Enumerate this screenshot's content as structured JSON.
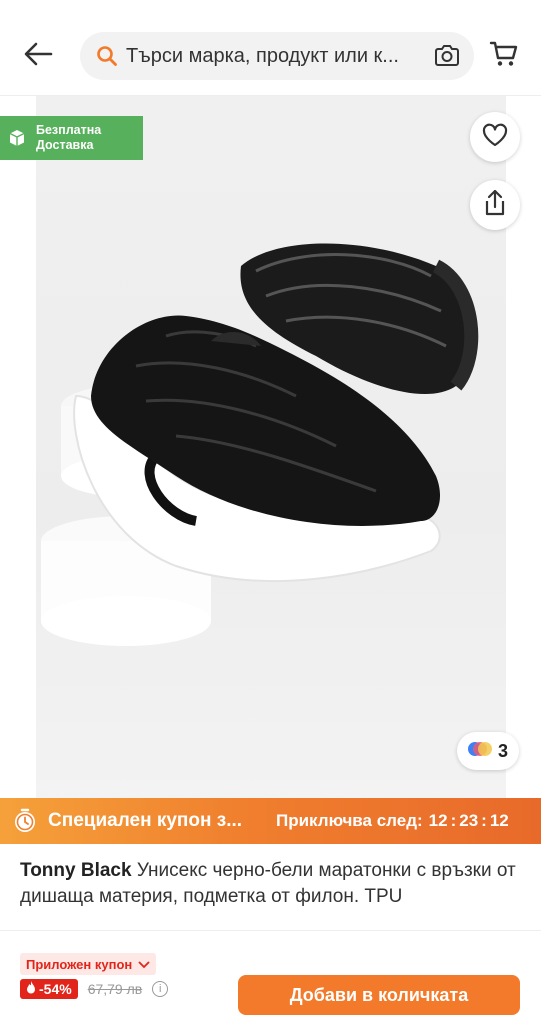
{
  "header": {
    "search_placeholder": "Търси марка, продукт или к...",
    "icons": [
      "back-arrow-icon",
      "search-icon",
      "camera-icon",
      "cart-icon"
    ]
  },
  "product_image": {
    "shipping_badge": {
      "line1": "Безплатна",
      "line2": "Доставка",
      "icon": "box-icon",
      "color": "#57b15c"
    },
    "wishlist_icon": "heart-icon",
    "share_icon": "share-icon",
    "variants_count": "3"
  },
  "coupon_banner": {
    "title": "Специален купон з...",
    "ends_label": "Приключва след:",
    "timer": {
      "hours": "12",
      "minutes": "23",
      "seconds": "12"
    },
    "colors": {
      "start": "#f5a13a",
      "end": "#e86a2a"
    }
  },
  "product": {
    "brand": "Tonny Black",
    "title": "Унисекс черно-бели маратонки с връзки от дишаща материя, подметка от филон. TPU"
  },
  "bottom_bar": {
    "applied_coupon_label": "Приложен купон",
    "discount": "-54%",
    "old_price": "67,79 лв",
    "add_to_cart_label": "Добави в количката",
    "accent_color": "#f27a2a"
  }
}
